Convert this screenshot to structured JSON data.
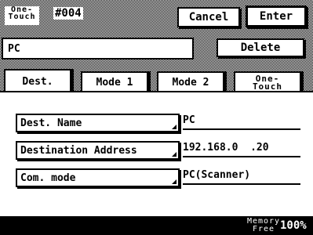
{
  "header": {
    "onetouch_line1": "One-",
    "onetouch_line2": "Touch",
    "number": "#004",
    "cancel_label": "Cancel",
    "enter_label": "Enter"
  },
  "name_field": {
    "value": "PC"
  },
  "delete_label": "Delete",
  "tabs": [
    {
      "label": "Dest."
    },
    {
      "label": "Mode 1"
    },
    {
      "label": "Mode 2"
    },
    {
      "label_line1": "One-",
      "label_line2": "Touch"
    }
  ],
  "rows": [
    {
      "label": "Dest. Name",
      "value": "PC"
    },
    {
      "label": "Destination Address",
      "value": "192.168.0  .20"
    },
    {
      "label": "Com. mode",
      "value": "PC(Scanner)"
    }
  ],
  "status": {
    "memory_line1": "Memory",
    "memory_line2": "Free",
    "percent": "100%"
  }
}
